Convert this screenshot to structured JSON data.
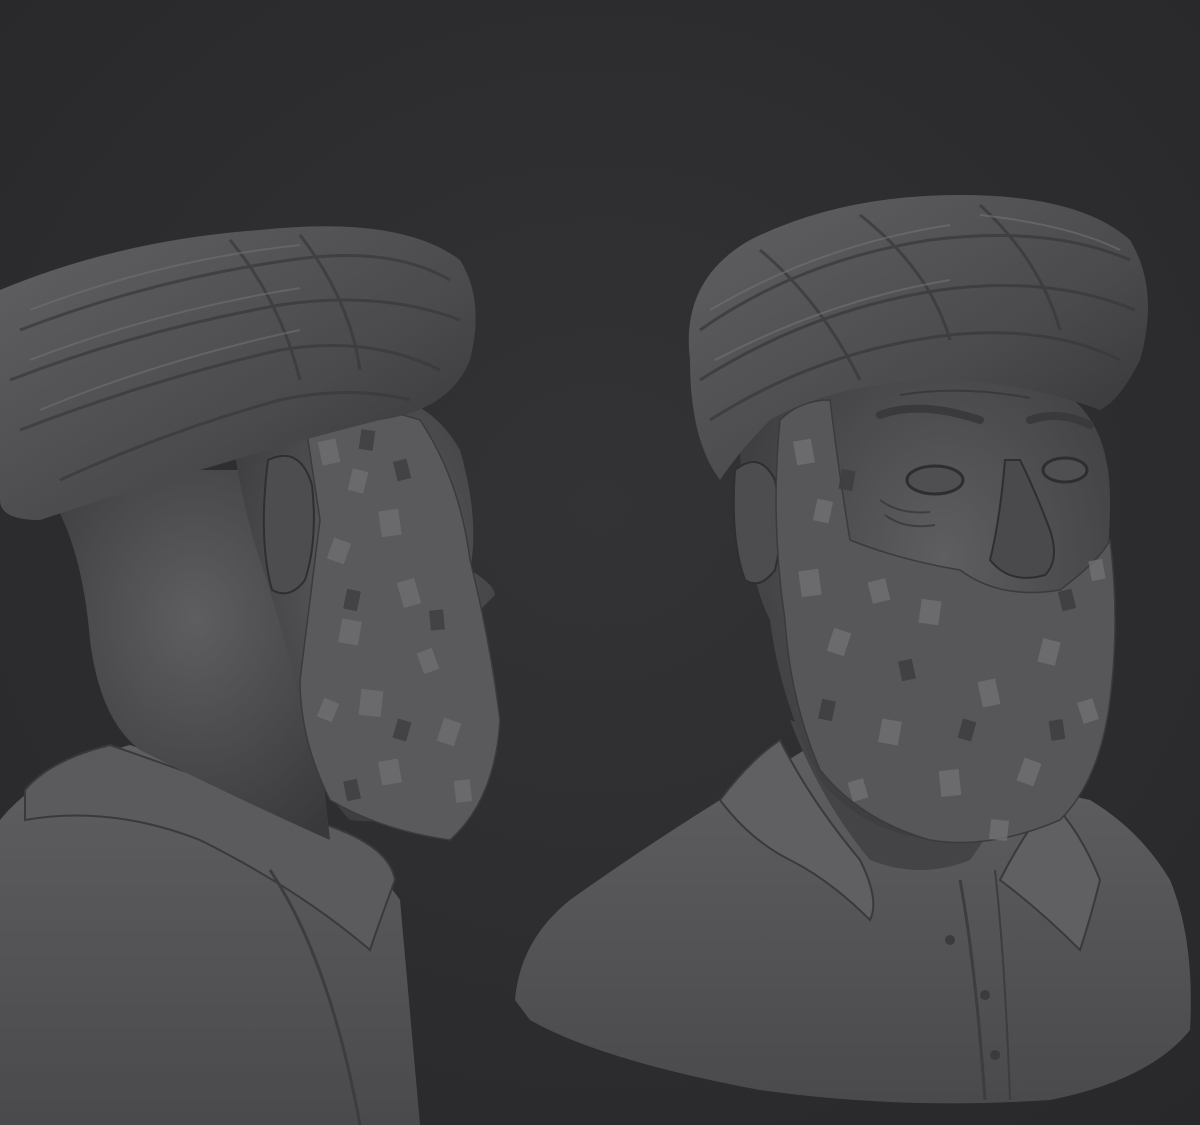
{
  "render": {
    "background_color": "#2c2c2e",
    "clay_color": "#5a5a5c"
  },
  "views": [
    {
      "name": "side-profile-view"
    },
    {
      "name": "three-quarter-view"
    }
  ]
}
